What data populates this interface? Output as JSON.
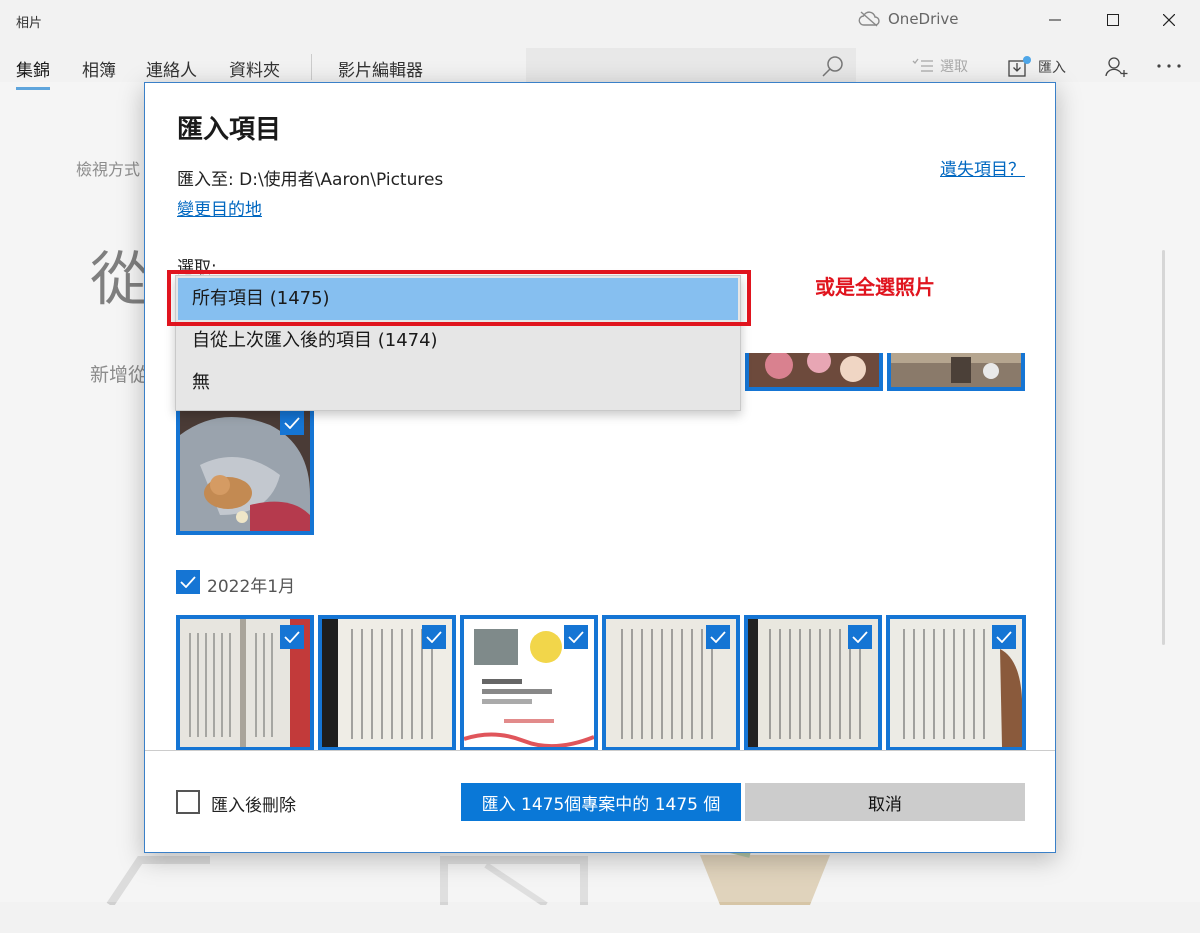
{
  "app": {
    "title": "相片",
    "onedrive_label": "OneDrive",
    "tabs": [
      {
        "label": "集錦",
        "active": true
      },
      {
        "label": "相簿",
        "active": false
      },
      {
        "label": "連絡人",
        "active": false
      },
      {
        "label": "資料夾",
        "active": false
      },
      {
        "label": "影片編輯器",
        "active": false
      }
    ],
    "toolbar": {
      "select_label": "選取",
      "import_label": "匯入"
    },
    "background": {
      "view_label": "檢視方式",
      "big_text": "從",
      "add_text": "新增從"
    }
  },
  "dialog": {
    "title": "匯入項目",
    "destination": "匯入至:  D:\\使用者\\Aaron\\Pictures",
    "change_link": "變更目的地",
    "missing_link": "遺失項目？",
    "select_label": "選取:",
    "dropdown": {
      "options": [
        {
          "label": "所有項目 (1475)",
          "selected": true
        },
        {
          "label": "自從上次匯入後的項目 (1474)",
          "selected": false
        },
        {
          "label": "無",
          "selected": false
        }
      ]
    },
    "annotation": "或是全選照片",
    "group": {
      "label": "2022年1月",
      "checked": true
    },
    "delete_after_import_label": "匯入後刪除",
    "delete_after_import_checked": false,
    "import_button_label": "匯入 1475個專案中的 1475 個",
    "cancel_button_label": "取消"
  },
  "colors": {
    "accent": "#0a78d7",
    "selection": "#86bff0",
    "annotation": "#e0141e",
    "link": "#0067c0"
  }
}
